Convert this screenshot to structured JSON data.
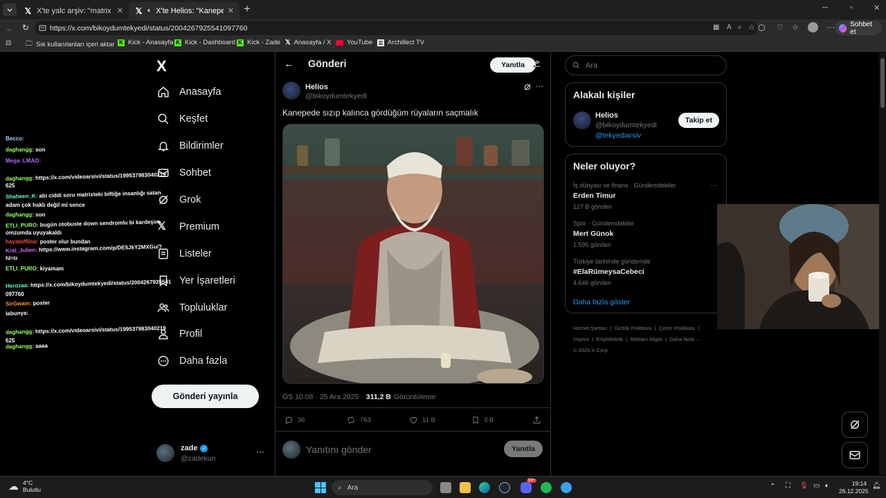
{
  "browser": {
    "tabs": [
      {
        "title": "X'te yalc arşiv: \"matrix - neden bay"
      },
      {
        "title": "X'te Helios: \"Kanepede sızıp kalınca"
      }
    ],
    "new_tab": "+",
    "url": "https://x.com/bikoydumtekyedi/status/2004267925541097760",
    "copilot_label": "Sohbet et",
    "bookmarks": [
      "Sık kullanılanları içeri aktar",
      "Kick - Anasayfa",
      "Kick - Dashboard",
      "Kick - Zade",
      "Anasayfa / X",
      "YouTube",
      "Archillect TV"
    ]
  },
  "nav": {
    "logo": "X",
    "items": [
      {
        "label": "Anasayfa",
        "icon": "home-icon"
      },
      {
        "label": "Keşfet",
        "icon": "search-icon"
      },
      {
        "label": "Bildirimler",
        "icon": "bell-icon"
      },
      {
        "label": "Sohbet",
        "icon": "mail-icon"
      },
      {
        "label": "Grok",
        "icon": "grok-icon"
      },
      {
        "label": "Premium",
        "icon": "x-icon"
      },
      {
        "label": "Listeler",
        "icon": "list-icon"
      },
      {
        "label": "Yer İşaretleri",
        "icon": "bookmark-icon"
      },
      {
        "label": "Topluluklar",
        "icon": "people-icon"
      },
      {
        "label": "Profil",
        "icon": "person-icon"
      },
      {
        "label": "Daha fazla",
        "icon": "more-circle-icon"
      }
    ],
    "post_button": "Gönderi yayınla",
    "account_name": "zade",
    "account_handle": "@zadekun"
  },
  "post": {
    "header_title": "Gönderi",
    "reply_button": "Yanıtla",
    "author_name": "Helios",
    "author_handle": "@bikoydumtekyedi",
    "text": "Kanepede sızıp kalınca gördüğüm rüyaların saçmalık",
    "time": "ÖS 10:08 · 25 Ara 2025 ·",
    "views": "311,2 B",
    "views_label": "Görüntüleme",
    "replies": "36",
    "reposts": "763",
    "likes": "11 B",
    "bookmarks": "3 B",
    "reply_placeholder": "Yanıtını gönder",
    "reply_submit": "Yanıtla"
  },
  "sidebar": {
    "search_placeholder": "Ara",
    "relevant_title": "Alakalı kişiler",
    "person_name": "Helios",
    "person_handle": "@bikoydumtekyedi",
    "person_bio": "@tekyediarsiv",
    "follow_button": "Takip et",
    "trends_title": "Neler oluyor?",
    "trends": [
      {
        "context": "İş dünyası ve finans · Gündemdekiler",
        "name": "Erden Timur",
        "count": "127 B gönderi"
      },
      {
        "context": "Spor · Gündemdekiler",
        "name": "Mert Günok",
        "count": "1.595 gönderi"
      },
      {
        "context": "Türkiye tarihinde gündemde",
        "name": "#ElaRümeysaCebeci",
        "count": "4.646 gönderi"
      }
    ],
    "show_more": "Daha fazla göster",
    "footer": [
      "Hizmet Şartları",
      "Gizlilik Politikası",
      "Çerez Politikası",
      "Imprint",
      "Erişilebilirlik",
      "Reklam bilgisi",
      "Daha fazla ···",
      "© 2025 X Corp."
    ]
  },
  "chat": [
    {
      "user": "Becco:",
      "color": "#9fd8ff",
      "msg": ""
    },
    {
      "user": "daghangg:",
      "color": "#9aff6b",
      "msg": "son"
    },
    {
      "user": "Mega_LMAO:",
      "color": "#b46bff",
      "msg": ""
    },
    {
      "user": "daghangg:",
      "color": "#9aff6b",
      "msg": "https://x.com/videoarsivi/status/199537983040219"
    },
    {
      "user": "",
      "color": "#fff",
      "msg": "625"
    },
    {
      "user": "Shaheen_K:",
      "color": "#6bffc3",
      "msg": "abi ciddi soru matrixteki biftiğe insanlığı satan"
    },
    {
      "user": "",
      "color": "#fff",
      "msg": "adam çok haklı değil mi sence"
    },
    {
      "user": "daghangg:",
      "color": "#9aff6b",
      "msg": "son"
    },
    {
      "user": "ETLI_PURO:",
      "color": "#9aff6b",
      "msg": "bugün otobuste down sendromlu bi kardeşim"
    },
    {
      "user": "",
      "color": "#fff",
      "msg": "omzumda uyuyakaldı"
    },
    {
      "user": "hayatoffline:",
      "color": "#ff4b4b",
      "msg": "poster olur bundan"
    },
    {
      "user": "Krai_Julien:",
      "color": "#d36bff",
      "msg": "https://www.instagram.com/p/DE5JkY2MXGu/?"
    },
    {
      "user": "",
      "color": "#fff",
      "msg": "hl=tr"
    },
    {
      "user": "ETLI_PURO:",
      "color": "#9aff6b",
      "msg": "kiyamam"
    },
    {
      "user": "Herozaa:",
      "color": "#6bffc3",
      "msg": "https://x.com/bikoydumtekyedi/status/2004267925541"
    },
    {
      "user": "",
      "color": "#fff",
      "msg": "097760"
    },
    {
      "user": "SirGwain:",
      "color": "#ff9b3b",
      "msg": "poster"
    },
    {
      "user": "labunya:",
      "color": "#fff",
      "msg": ""
    },
    {
      "user": "daghangg:",
      "color": "#9aff6b",
      "msg": "https://x.com/videoarsivi/status/199537983040219"
    },
    {
      "user": "",
      "color": "#fff",
      "msg": "625"
    },
    {
      "user": "daghangg:",
      "color": "#9aff6b",
      "msg": "aaaa"
    }
  ],
  "taskbar": {
    "weather_temp": "4°C",
    "weather_text": "Bulutlu",
    "search_placeholder": "Ara",
    "time": "19:14",
    "date": "26.12.2025",
    "notif_badge": "99+"
  }
}
